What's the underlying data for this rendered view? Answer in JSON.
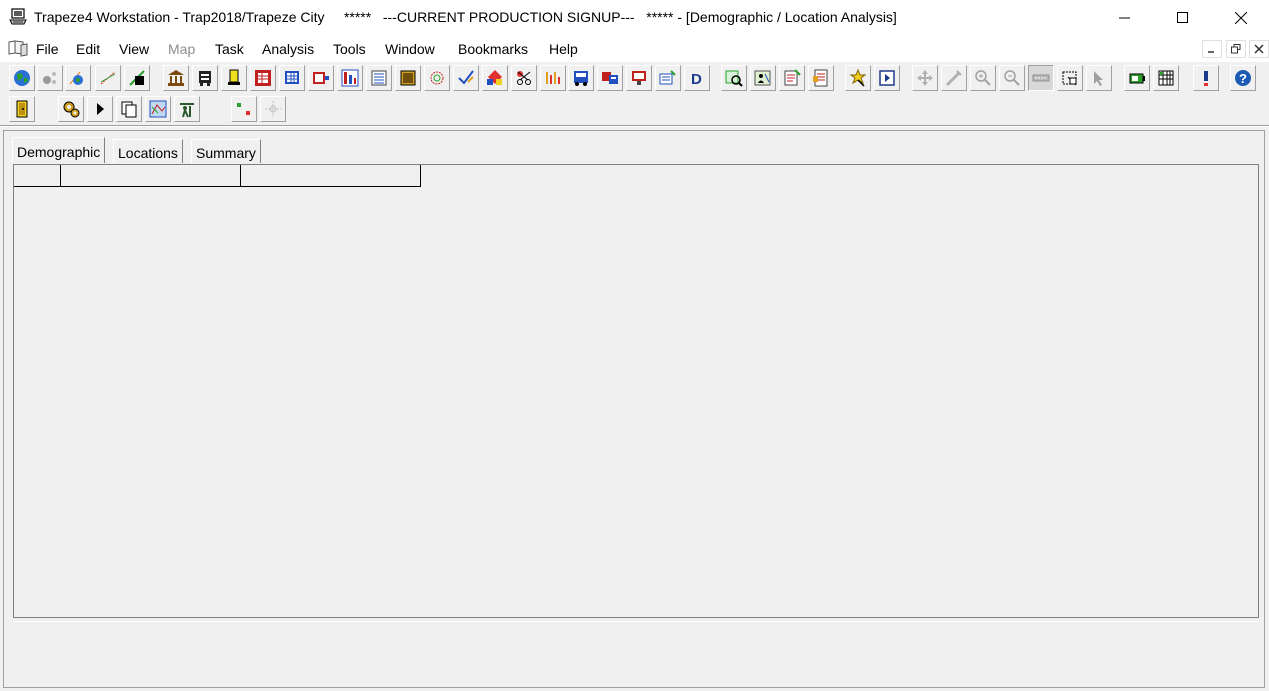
{
  "window": {
    "title": "Trapeze4 Workstation - Trap2018/Trapeze City     *****   ---CURRENT PRODUCTION SIGNUP---   ***** - [Demographic / Location Analysis]",
    "controls": {
      "minimize_icon": "minimize-icon",
      "maximize_icon": "maximize-icon",
      "close_icon": "close-icon"
    }
  },
  "menubar": {
    "items": [
      {
        "label": "File",
        "enabled": true
      },
      {
        "label": "Edit",
        "enabled": true
      },
      {
        "label": "View",
        "enabled": true
      },
      {
        "label": "Map",
        "enabled": false
      },
      {
        "label": "Task",
        "enabled": true
      },
      {
        "label": "Analysis",
        "enabled": true
      },
      {
        "label": "Tools",
        "enabled": true
      },
      {
        "label": "Window",
        "enabled": true
      },
      {
        "label": "Bookmarks",
        "enabled": true
      },
      {
        "label": "Help",
        "enabled": true
      }
    ],
    "mdi_controls": [
      "mdi-minimize-icon",
      "mdi-restore-icon",
      "mdi-close-icon"
    ]
  },
  "toolbar1": {
    "icons": [
      "globe-icon",
      "gray-nodes-icon",
      "map-stops-icon",
      "route-lines-icon",
      "pattern-icon",
      "building-icon",
      "garage-icon",
      "bell-icon",
      "schedule-grid-icon",
      "runs-icon",
      "blocks-icon",
      "trip-chart-icon",
      "list-icon",
      "book-icon",
      "circle-path-icon",
      "check-edit-icon",
      "color-blocks-icon",
      "scissors-icon",
      "bars-icon",
      "bus-icon",
      "transfer-icon",
      "monitor-icon",
      "vehicle-edit-icon",
      "d-icon",
      "map-search-icon",
      "map-people-icon",
      "notes-icon",
      "report-icon",
      "star-pin-icon",
      "play-window-icon",
      "pan-icon",
      "measure-icon",
      "zoom-in-icon",
      "zoom-out-icon",
      "street-icon",
      "select-area-icon",
      "pointer-icon",
      "battery-icon",
      "calendar-grid-icon",
      "alert-icon",
      "help-icon"
    ]
  },
  "toolbar2": {
    "icons": [
      "exit-door-icon",
      "gears-icon",
      "play-icon",
      "copy-pages-icon",
      "map-layers-icon",
      "people-walk-icon",
      "dots-color-icon",
      "split-node-icon"
    ]
  },
  "tabs": [
    {
      "label": "Demographic",
      "active": true
    },
    {
      "label": "Locations",
      "active": false
    },
    {
      "label": "Summary",
      "active": false
    }
  ],
  "grid": {
    "columns": [
      "",
      "",
      ""
    ]
  }
}
